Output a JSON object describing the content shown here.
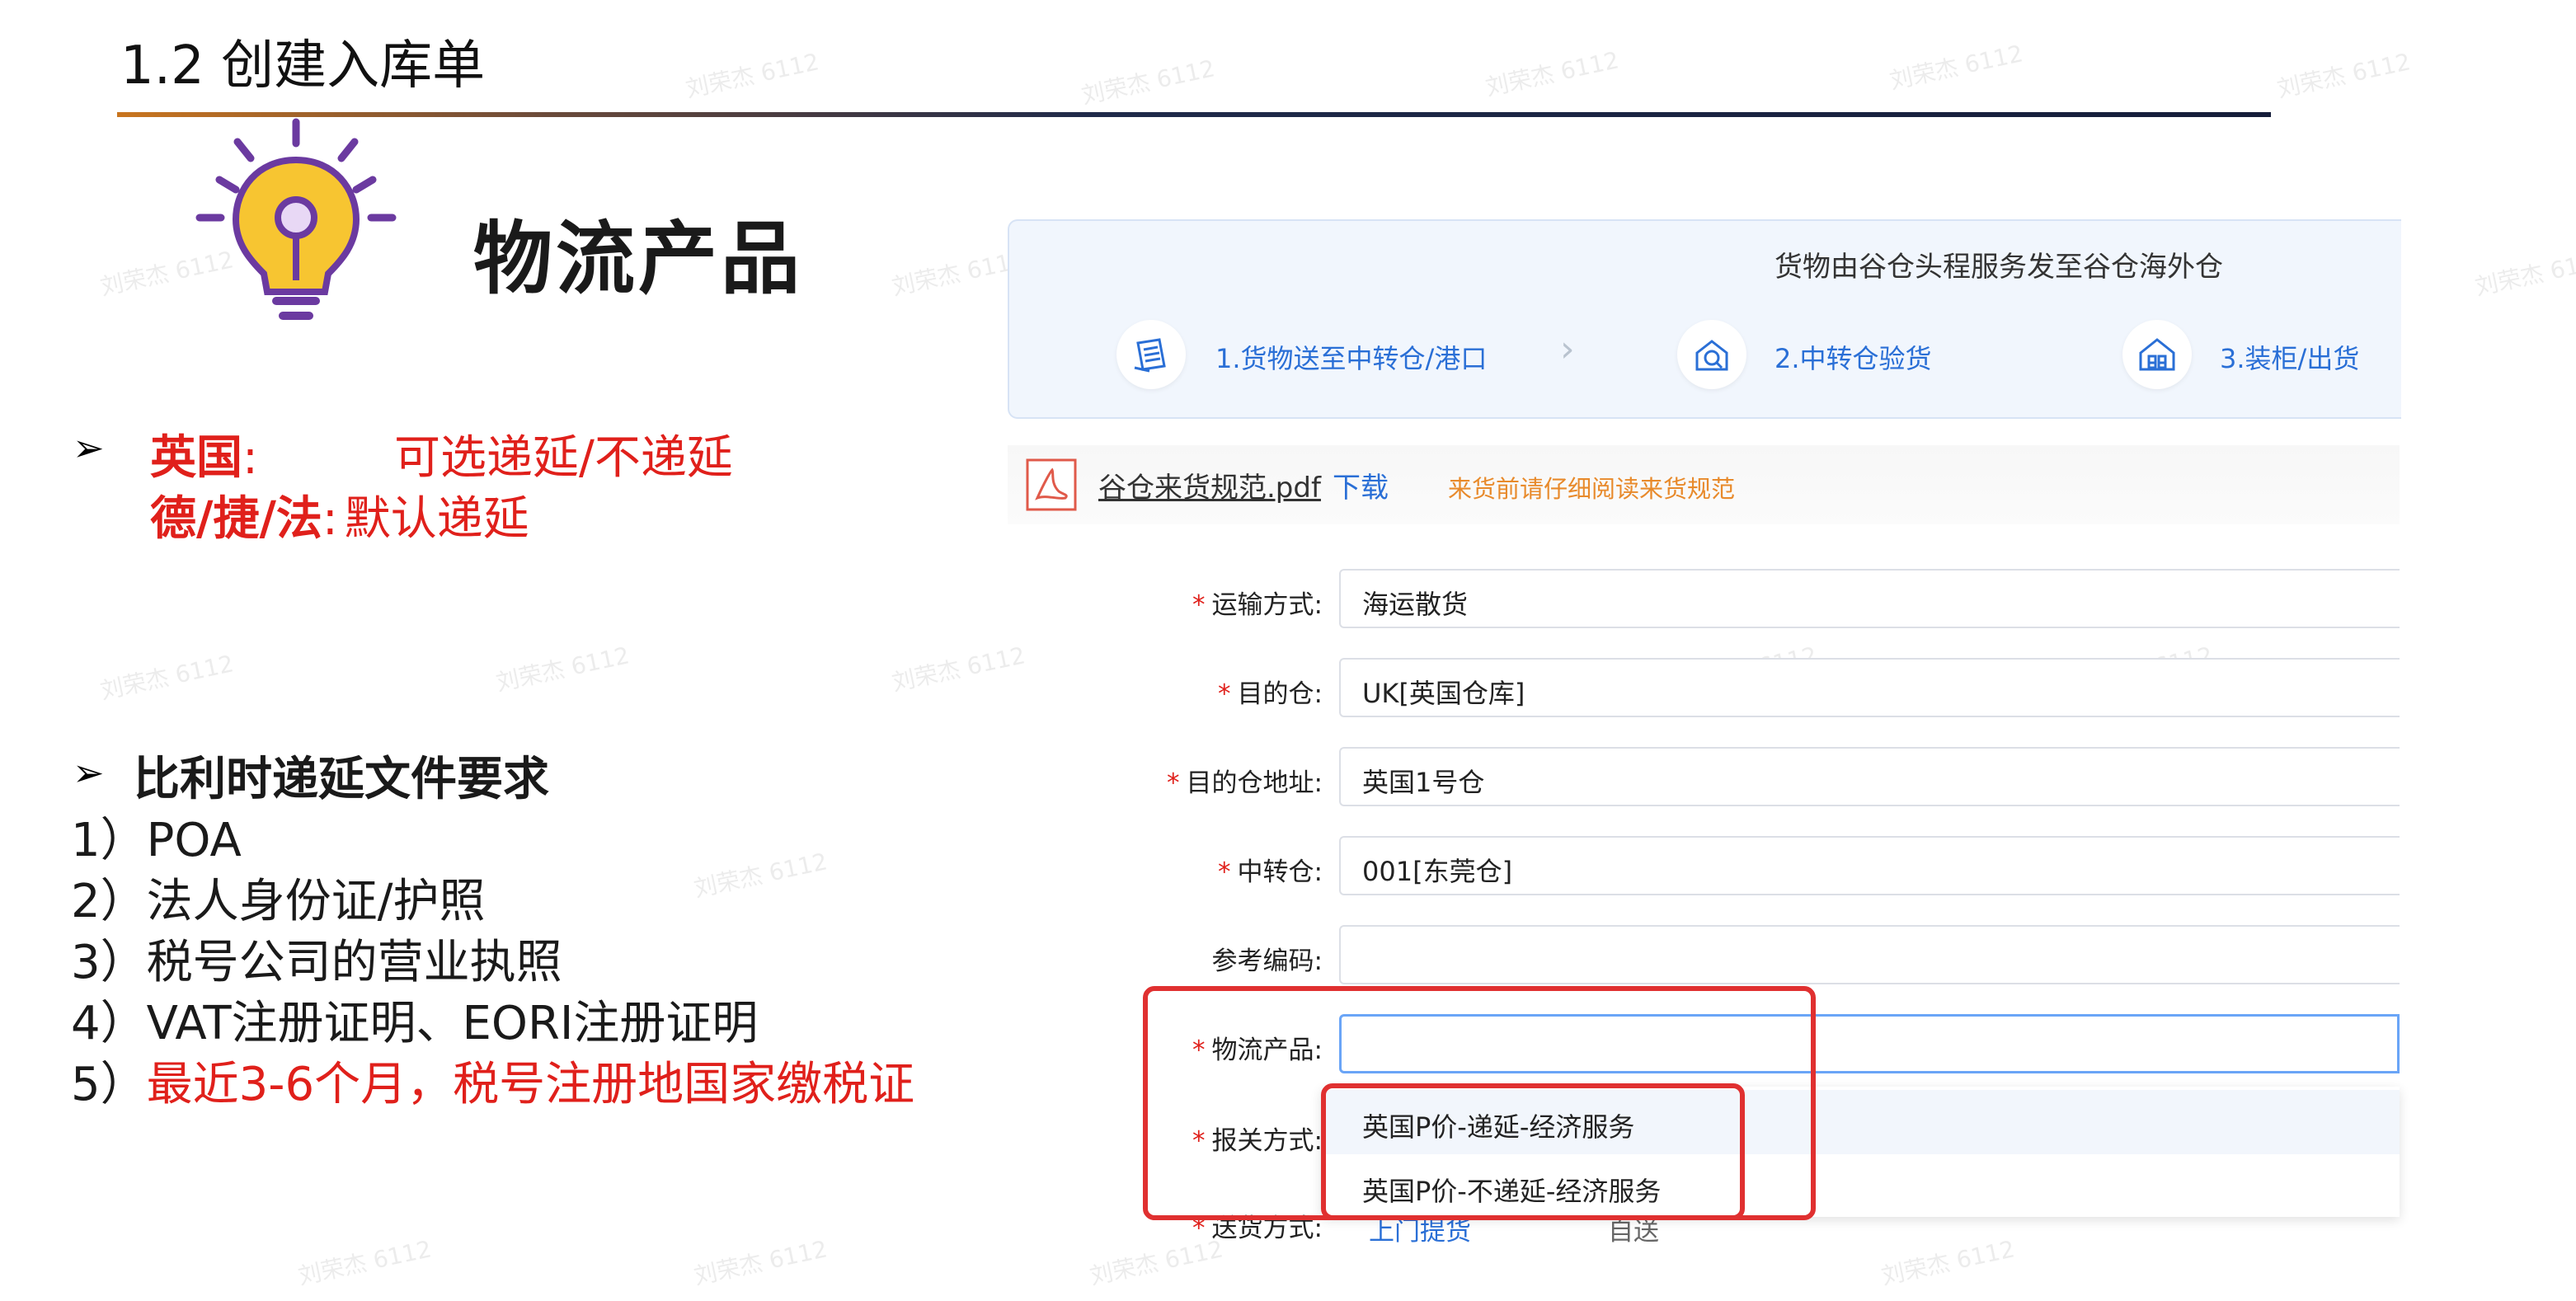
{
  "slide": {
    "title": "1.2 创建入库单",
    "heading": "物流产品"
  },
  "left": {
    "bullet1": {
      "country_a": "英国",
      "sep": ":",
      "value_a": "可选递延/不递延",
      "country_b": "德/捷/法",
      "value_b": "默认递延"
    },
    "bullet2": {
      "heading": "比利时递延文件要求",
      "items": [
        {
          "num": "1）",
          "text": "POA"
        },
        {
          "num": "2）",
          "text": "法人身份证/护照"
        },
        {
          "num": "3）",
          "text": "税号公司的营业执照"
        },
        {
          "num": "4）",
          "text": "VAT注册证明、EORI注册证明"
        },
        {
          "num": "5）",
          "text": "最近3-6个月，税号注册地国家缴税证"
        }
      ]
    }
  },
  "panel": {
    "title": "货物由谷仓头程服务发至谷仓海外仓",
    "steps": [
      {
        "label": "1.货物送至中转仓/港口",
        "icon": "document-icon"
      },
      {
        "label": "2.中转仓验货",
        "icon": "warehouse-check-icon"
      },
      {
        "label": "3.装柜/出货",
        "icon": "container-icon"
      }
    ]
  },
  "pdf": {
    "filename": "谷仓来货规范.pdf",
    "download": "下载",
    "warning": "来货前请仔细阅读来货规范"
  },
  "form": {
    "fields": [
      {
        "label": "运输方式:",
        "required": true,
        "value": "海运散货"
      },
      {
        "label": "目的仓:",
        "required": true,
        "value": "UK[英国仓库]"
      },
      {
        "label": "目的仓地址:",
        "required": true,
        "value": "英国1号仓"
      },
      {
        "label": "中转仓:",
        "required": true,
        "value": "001[东莞仓]"
      },
      {
        "label": "参考编码:",
        "required": false,
        "value": ""
      },
      {
        "label": "物流产品:",
        "required": true,
        "value": ""
      },
      {
        "label": "报关方式:",
        "required": true,
        "value": ""
      },
      {
        "label": "送货方式:",
        "required": true,
        "value": ""
      }
    ],
    "dropdown_options": [
      "英国P价-递延-经济服务",
      "英国P价-不递延-经济服务"
    ],
    "delivery_partial": [
      "上门提货",
      "自送"
    ]
  },
  "watermark": "刘荣杰 6112",
  "colors": {
    "accent_red": "#e0201b",
    "link_blue": "#2a6fd6",
    "warn_orange": "#e88a2b"
  }
}
